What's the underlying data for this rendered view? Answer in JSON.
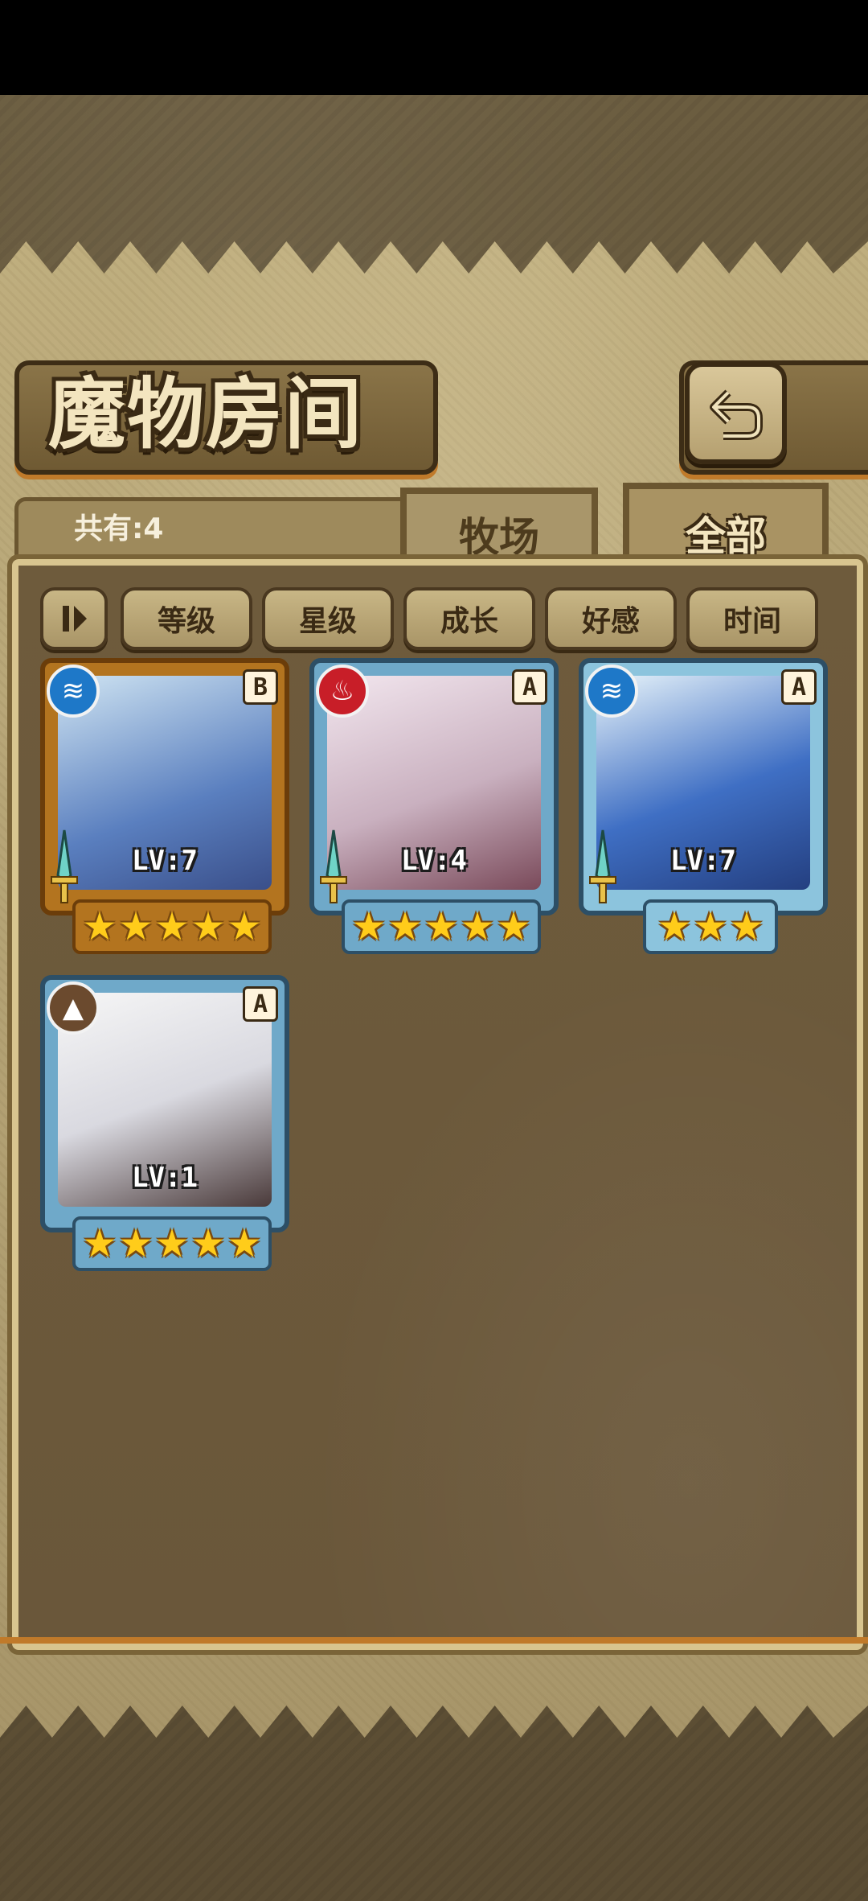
{
  "header": {
    "title": "魔物房间",
    "back_icon": "return-arrow-icon"
  },
  "tabs": {
    "count_text": "共有:4",
    "ranch_label": "牧场",
    "all_label": "全部"
  },
  "sort_bar": {
    "pause_icon": "sort-toggle-icon",
    "buttons": [
      "等级",
      "星级",
      "成长",
      "好感",
      "时间"
    ]
  },
  "monsters": [
    {
      "element": "water",
      "grade": "B",
      "level": "LV:7",
      "stars": 5,
      "frame_color": "#b3741f"
    },
    {
      "element": "fire",
      "grade": "A",
      "level": "LV:4",
      "stars": 5,
      "frame_color": "#6fa9c9"
    },
    {
      "element": "water",
      "grade": "A",
      "level": "LV:7",
      "stars": 3,
      "frame_color": "#8cc4dd"
    },
    {
      "element": "earth",
      "grade": "A",
      "level": "LV:1",
      "stars": 5,
      "frame_color": "#6fa9c9"
    }
  ]
}
